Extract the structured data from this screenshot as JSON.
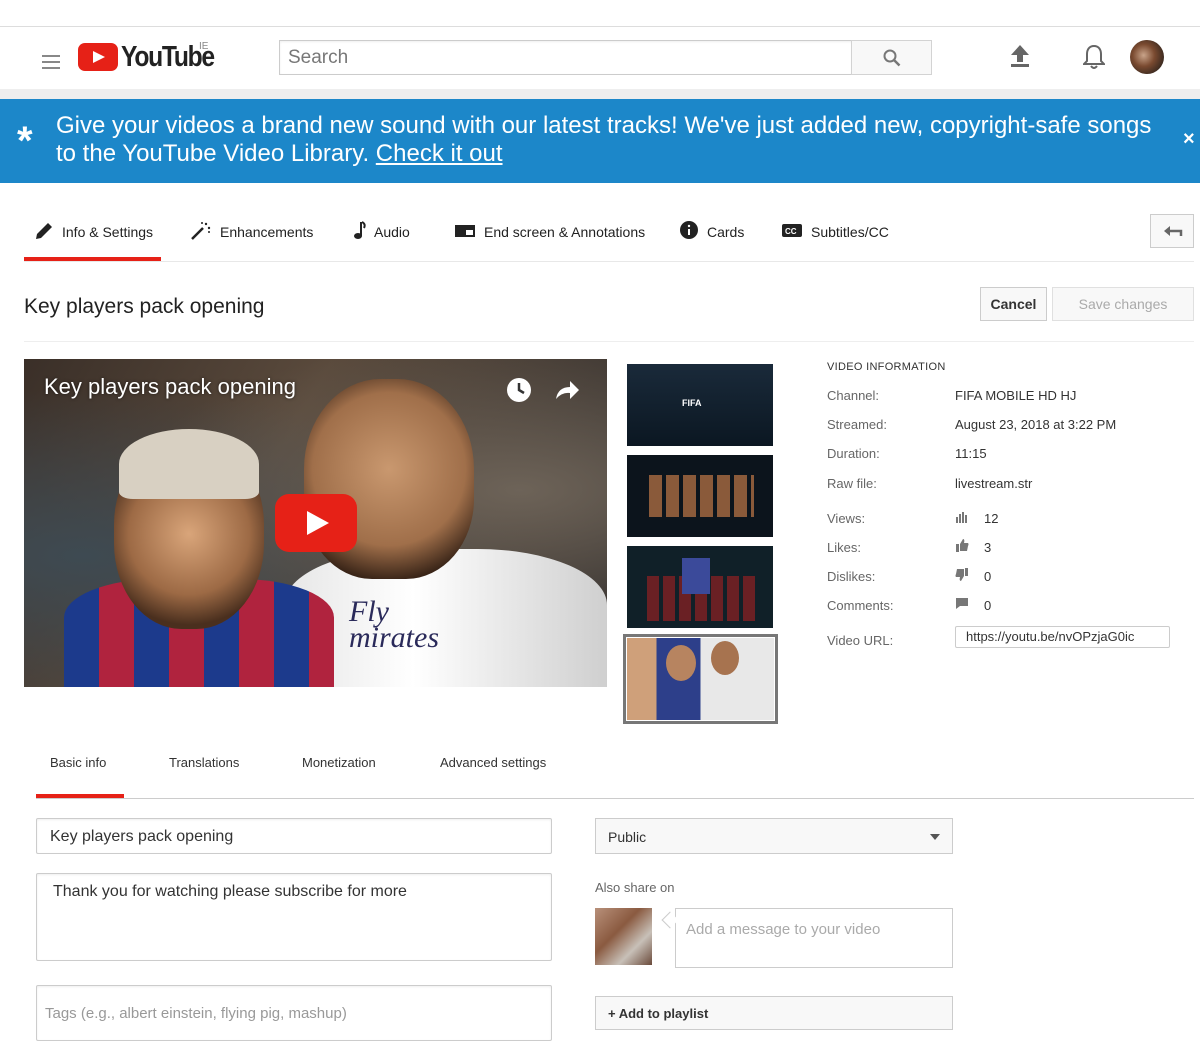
{
  "header": {
    "logo_text": "YouTube",
    "country_code": "IE",
    "search_placeholder": "Search",
    "icons": [
      "menu-icon",
      "search-icon",
      "upload-icon",
      "bell-icon",
      "avatar"
    ]
  },
  "banner": {
    "text": "Give your videos a brand new sound with our latest tracks! We've just added new, copyright-safe songs to the YouTube Video Library.",
    "link": "Check it out",
    "star": "*",
    "close": "×",
    "color": "#1c87c9"
  },
  "tabs": [
    {
      "label": "Info & Settings",
      "icon": "pencil-icon",
      "active": true
    },
    {
      "label": "Enhancements",
      "icon": "magic-wand-icon"
    },
    {
      "label": "Audio",
      "icon": "music-note-icon"
    },
    {
      "label": "End screen & Annotations",
      "icon": "end-screen-icon"
    },
    {
      "label": "Cards",
      "icon": "info-icon"
    },
    {
      "label": "Subtitles/CC",
      "icon": "cc-icon"
    }
  ],
  "page": {
    "title": "Key players pack opening",
    "cancel_label": "Cancel",
    "save_label": "Save changes"
  },
  "player": {
    "title": "Key players pack opening",
    "shirt_text": "Fly\nmirates",
    "thumb1_text": "FIFA"
  },
  "video_info": {
    "heading": "VIDEO INFORMATION",
    "channel_label": "Channel:",
    "channel": "FIFA MOBILE HD HJ",
    "streamed_label": "Streamed:",
    "streamed": "August 23, 2018 at 3:22 PM",
    "duration_label": "Duration:",
    "duration": "11:15",
    "raw_file_label": "Raw file:",
    "raw_file": "livestream.str",
    "views_label": "Views:",
    "views": "12",
    "likes_label": "Likes:",
    "likes": "3",
    "dislikes_label": "Dislikes:",
    "dislikes": "0",
    "comments_label": "Comments:",
    "comments": "0",
    "url_label": "Video URL:",
    "url": "https://youtu.be/nvOPzjaG0ic"
  },
  "sub_tabs": [
    {
      "label": "Basic info",
      "active": true
    },
    {
      "label": "Translations"
    },
    {
      "label": "Monetization"
    },
    {
      "label": "Advanced settings"
    }
  ],
  "form": {
    "title_value": "Key players pack opening",
    "description_value": "Thank you for watching please subscribe for more",
    "tags_placeholder": "Tags (e.g., albert einstein, flying pig, mashup)",
    "privacy": "Public",
    "also_share": "Also share on",
    "message_placeholder": "Add a message to your video",
    "add_playlist": "+ Add to playlist"
  },
  "colors": {
    "accent_red": "#e62117",
    "banner_blue": "#1c87c9"
  }
}
